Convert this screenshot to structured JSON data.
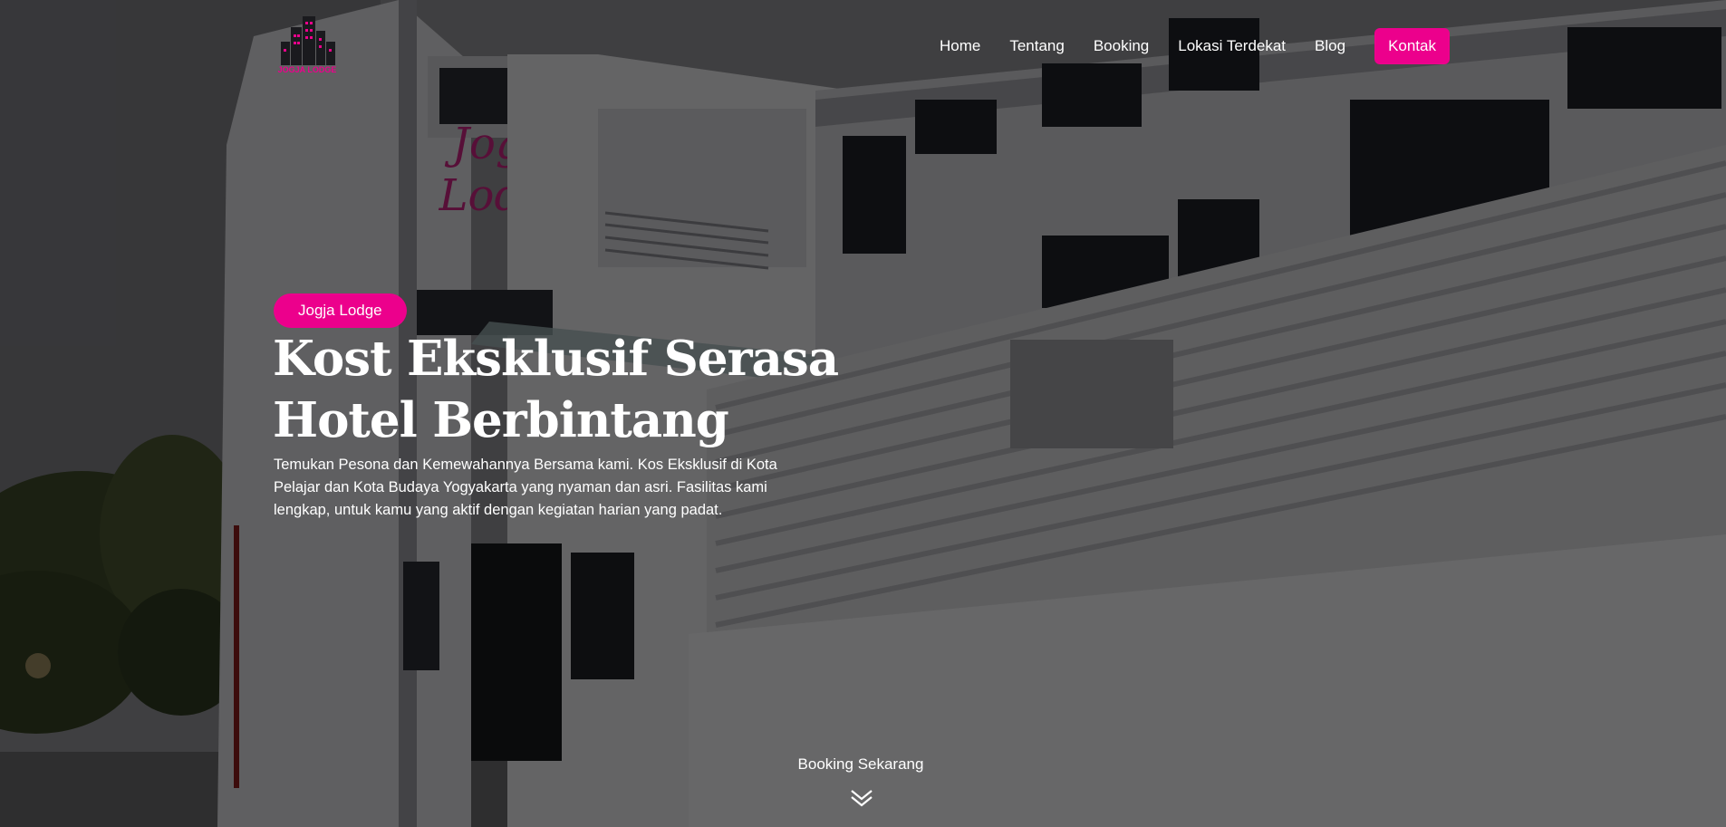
{
  "brand": {
    "logo_text": "JOGJA LODGE",
    "accent_color": "#ec008c"
  },
  "nav": {
    "items": [
      {
        "label": "Home"
      },
      {
        "label": "Tentang"
      },
      {
        "label": "Booking"
      },
      {
        "label": "Lokasi Terdekat"
      },
      {
        "label": "Blog"
      }
    ],
    "contact_label": "Kontak"
  },
  "hero": {
    "badge": "Jogja Lodge",
    "headline": "Kost Eksklusif Serasa Hotel Berbintang",
    "description": "Temukan Pesona dan Kemewahannya Bersama kami. Kos Eksklusif di Kota Pelajar dan Kota Budaya Yogyakarta yang nyaman dan asri. Fasilitas kami lengkap, untuk kamu yang aktif dengan kegiatan harian yang padat.",
    "building_sign": "Jogja Lodge",
    "cta_label": "Booking Sekarang",
    "cta_icon": "chevron-double-down-icon"
  }
}
